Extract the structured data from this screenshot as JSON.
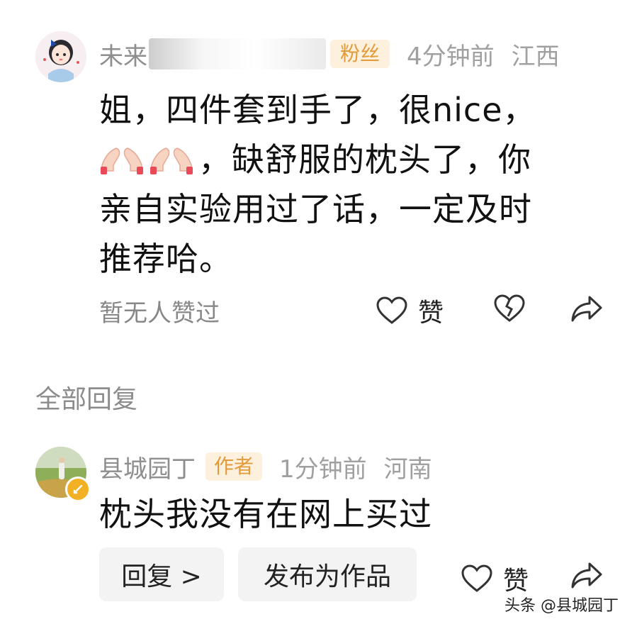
{
  "comment": {
    "username": "未来",
    "fan_badge": "粉丝",
    "time": "4分钟前",
    "location": "江西",
    "text_line1": "姐，四件套到手了，很nice，",
    "text_line2": "，缺舒服的枕头了，你",
    "text_line3": "亲自实验用过了话，一定及时",
    "text_line4": "推荐哈。",
    "likes_status": "暂无人赞过",
    "like_label": "赞",
    "icons": {
      "like": "heart-icon",
      "dislike": "broken-heart-icon",
      "share": "share-arrow-icon",
      "emoji": "clapping-hands-emoji"
    }
  },
  "replies_header": "全部回复",
  "reply": {
    "username": "县城园丁",
    "author_badge": "作者",
    "time": "1分钟前",
    "location": "河南",
    "text": "枕头我没有在网上买过",
    "reply_button": "回复 >",
    "publish_button": "发布为作品",
    "like_label": "赞"
  },
  "watermark": "头条 @县城园丁",
  "colors": {
    "badge_bg": "#fdf0dc",
    "badge_text": "#e39a3a",
    "muted_text": "#9a9a9a",
    "pill_bg": "#f3f3f3"
  }
}
